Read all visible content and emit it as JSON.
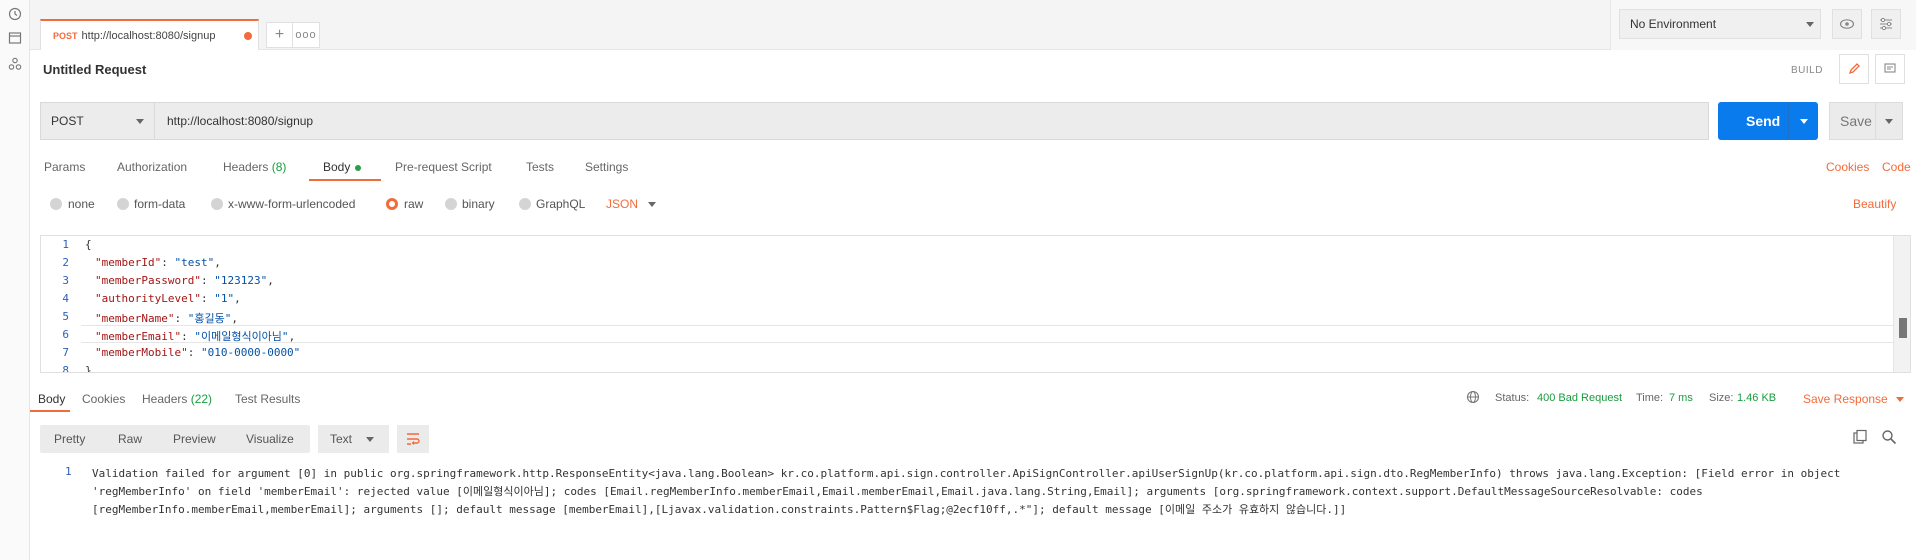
{
  "app": {
    "accent": "#f26b3a",
    "primary": "#097bed",
    "success": "#1a9c3e"
  },
  "rail": {
    "icons": [
      "history-icon",
      "collections-icon",
      "apis-icon"
    ]
  },
  "tabs": {
    "active": {
      "method": "POST",
      "url": "http://localhost:8080/signup"
    },
    "add_label": "+",
    "more_label": "ooo"
  },
  "environment": {
    "selected": "No Environment"
  },
  "request": {
    "title": "Untitled Request",
    "build_label": "BUILD",
    "method": "POST",
    "url": "http://localhost:8080/signup",
    "send_label": "Send",
    "save_label": "Save"
  },
  "request_tabs": {
    "params": "Params",
    "authorization": "Authorization",
    "headers": "Headers",
    "headers_count": "(8)",
    "body": "Body",
    "prerequest": "Pre-request Script",
    "tests": "Tests",
    "settings": "Settings",
    "cookies": "Cookies",
    "code": "Code"
  },
  "body_types": {
    "none": "none",
    "form_data": "form-data",
    "urlencoded": "x-www-form-urlencoded",
    "raw": "raw",
    "binary": "binary",
    "graphql": "GraphQL",
    "format": "JSON",
    "beautify": "Beautify"
  },
  "editor": {
    "lines": [
      {
        "n": "1",
        "open": "{"
      },
      {
        "n": "2",
        "key": "\"memberId\"",
        "value": "\"test\"",
        "tail": ","
      },
      {
        "n": "3",
        "key": "\"memberPassword\"",
        "value": "\"123123\"",
        "tail": ","
      },
      {
        "n": "4",
        "key": "\"authorityLevel\"",
        "value": "\"1\"",
        "tail": ","
      },
      {
        "n": "5",
        "key": "\"memberName\"",
        "value": "\"홍길동\"",
        "tail": ","
      },
      {
        "n": "6",
        "key": "\"memberEmail\"",
        "value": "\"이메일형식이아님\"",
        "tail": ","
      },
      {
        "n": "7",
        "key": "\"memberMobile\"",
        "value": "\"010-0000-0000\"",
        "tail": ""
      },
      {
        "n": "8",
        "open": "}"
      }
    ]
  },
  "response": {
    "tabs": {
      "body": "Body",
      "cookies": "Cookies",
      "headers": "Headers",
      "headers_count": "(22)",
      "test_results": "Test Results"
    },
    "status_label": "Status:",
    "status_value": "400 Bad Request",
    "time_label": "Time:",
    "time_value": "7 ms",
    "size_label": "Size:",
    "size_value": "1.46 KB",
    "save_response": "Save Response",
    "formats": {
      "pretty": "Pretty",
      "raw": "Raw",
      "preview": "Preview",
      "visualize": "Visualize"
    },
    "view_type": "Text",
    "line_number": "1",
    "body_text": "Validation failed for argument [0] in public org.springframework.http.ResponseEntity<java.lang.Boolean> kr.co.platform.api.sign.controller.ApiSignController.apiUserSignUp(kr.co.platform.api.sign.dto.RegMemberInfo) throws java.lang.Exception: [Field error in object 'regMemberInfo' on field 'memberEmail': rejected value [이메일형식이아님]; codes [Email.regMemberInfo.memberEmail,Email.memberEmail,Email.java.lang.String,Email]; arguments [org.springframework.context.support.DefaultMessageSourceResolvable: codes [regMemberInfo.memberEmail,memberEmail]; arguments []; default message [memberEmail],[Ljavax.validation.constraints.Pattern$Flag;@2ecf10ff,.*\"]; default message [이메일 주소가 유효하지 않습니다.]]"
  }
}
